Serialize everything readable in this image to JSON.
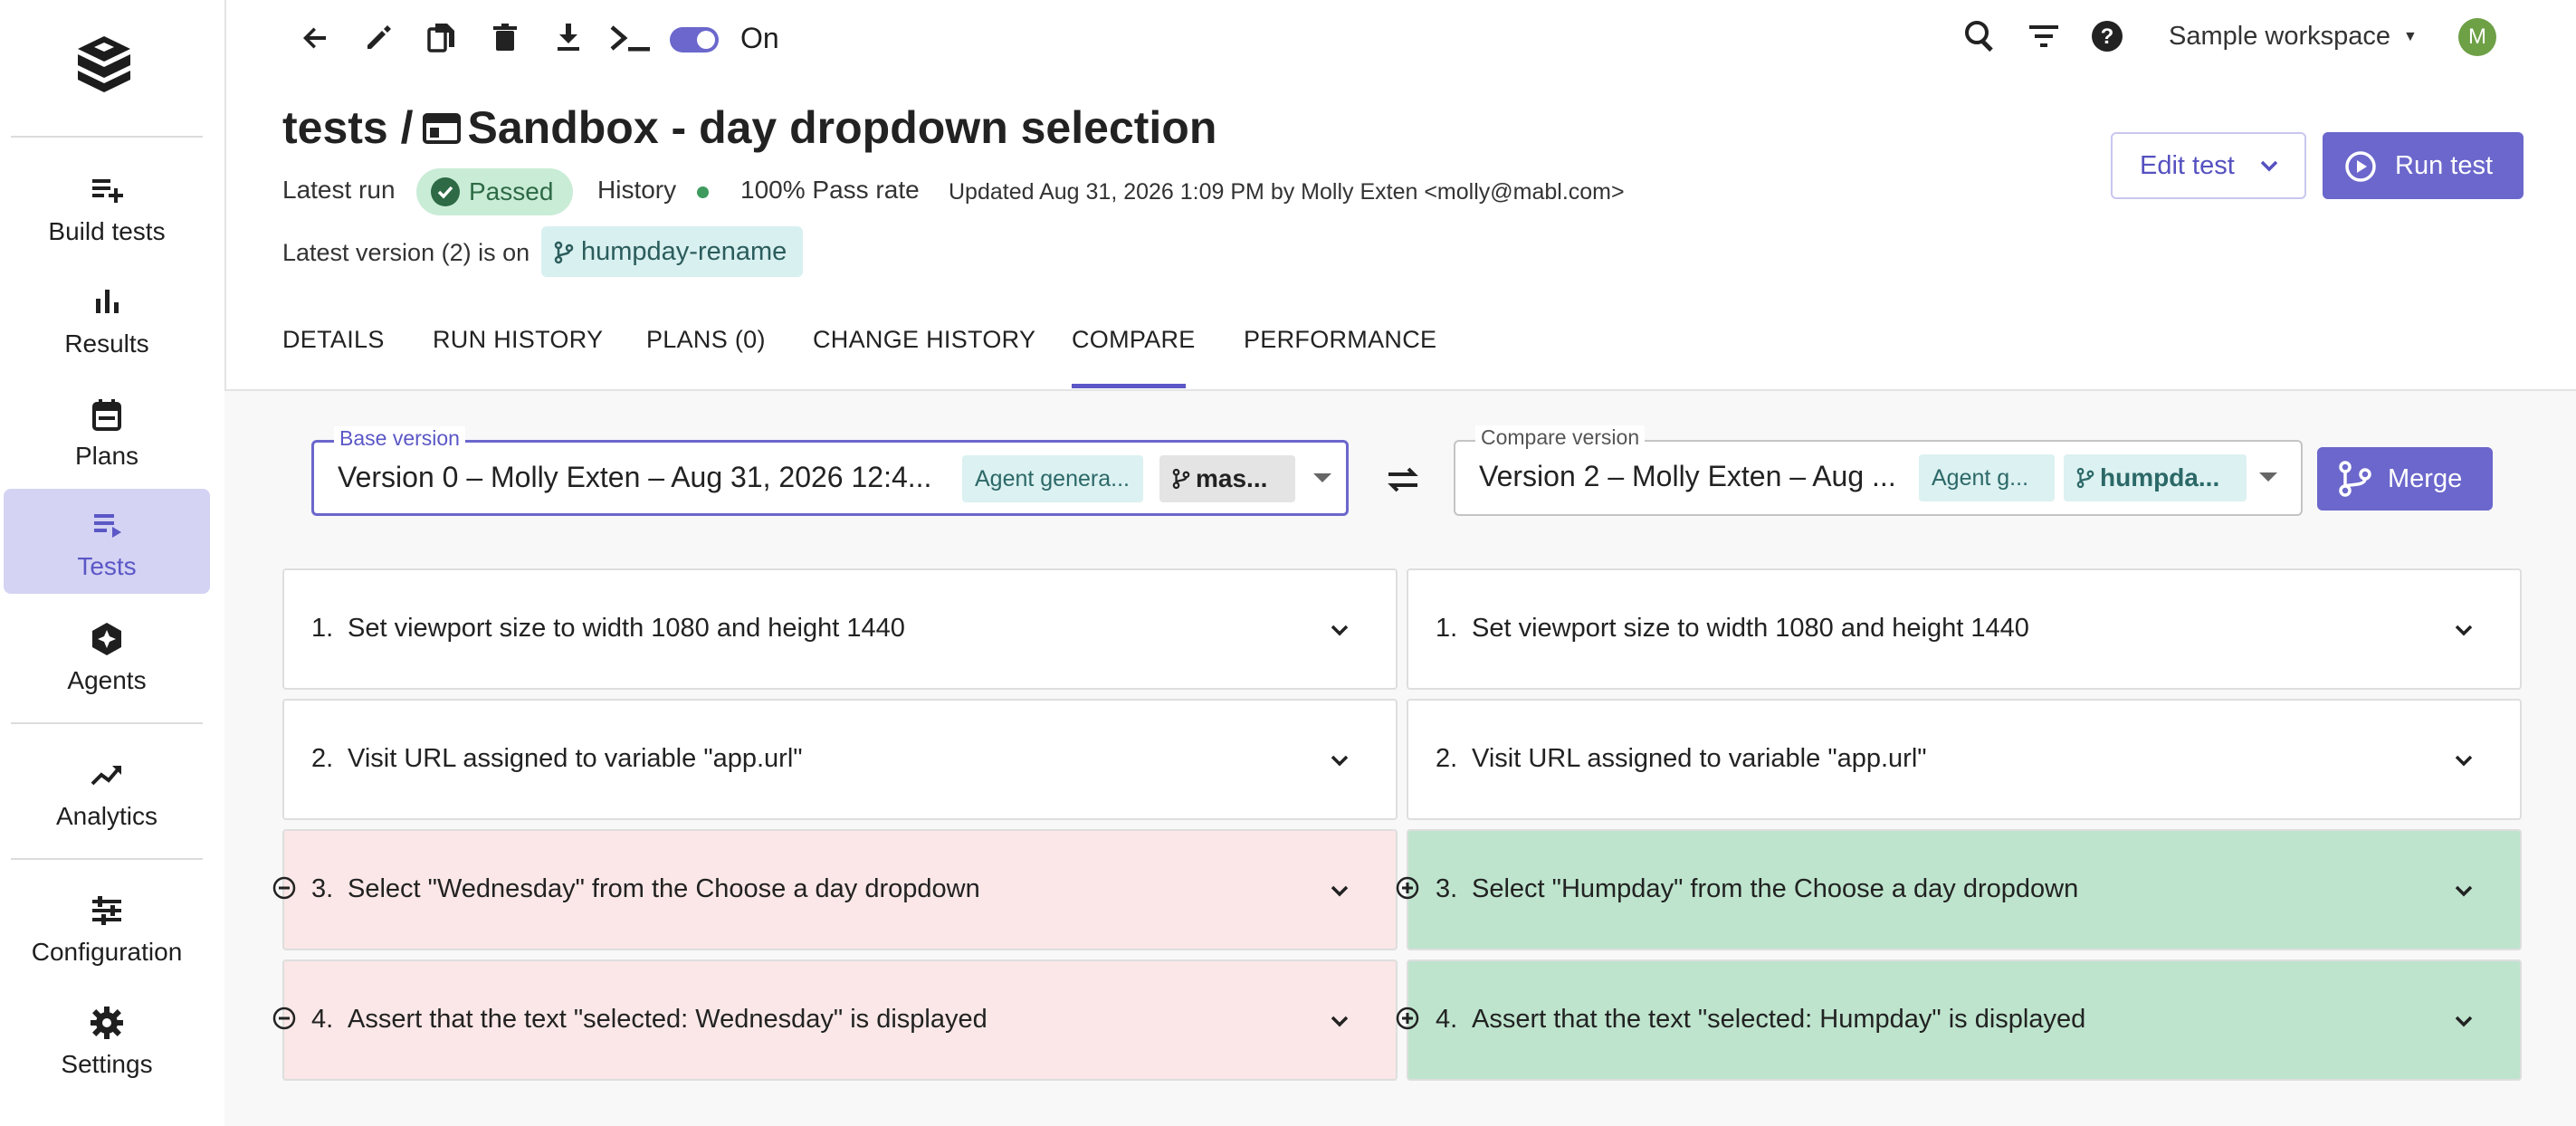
{
  "sidebar": {
    "items": [
      {
        "label": "Build tests",
        "icon": "build-tests-icon"
      },
      {
        "label": "Results",
        "icon": "bar-chart-icon"
      },
      {
        "label": "Plans",
        "icon": "calendar-icon"
      },
      {
        "label": "Tests",
        "icon": "list-icon",
        "active": true
      },
      {
        "label": "Agents",
        "icon": "agent-icon"
      },
      {
        "label": "Analytics",
        "icon": "trend-icon"
      },
      {
        "label": "Configuration",
        "icon": "sliders-icon"
      },
      {
        "label": "Settings",
        "icon": "gear-icon"
      }
    ]
  },
  "toolbar": {
    "toggle_label": "On",
    "workspace": "Sample workspace",
    "avatar_initial": "M"
  },
  "header": {
    "breadcrumb": "tests /",
    "title": "Sandbox - day dropdown selection",
    "latest_run_label": "Latest run",
    "status": "Passed",
    "history_label": "History",
    "pass_rate": "100% Pass rate",
    "updated": "Updated Aug 31, 2026 1:09 PM by Molly Exten <molly@mabl.com>",
    "latest_version_text": "Latest version (2) is on",
    "branch": "humpday-rename",
    "edit_label": "Edit test",
    "run_label": "Run test"
  },
  "tabs": [
    "DETAILS",
    "RUN HISTORY",
    "PLANS (0)",
    "CHANGE HISTORY",
    "COMPARE",
    "PERFORMANCE"
  ],
  "active_tab": "COMPARE",
  "compare": {
    "base": {
      "legend": "Base version",
      "value": "Version 0 – Molly Exten – Aug 31, 2026 12:4...",
      "agent_chip": "Agent genera...",
      "branch_chip": "mas..."
    },
    "target": {
      "legend": "Compare version",
      "value": "Version 2 – Molly Exten – Aug ...",
      "agent_chip": "Agent g...",
      "branch_chip": "humpda..."
    },
    "merge_label": "Merge",
    "left_steps": [
      {
        "num": "1.",
        "text": "Set viewport size to width 1080 and height 1440",
        "state": "same"
      },
      {
        "num": "2.",
        "text": "Visit URL assigned to variable \"app.url\"",
        "state": "same"
      },
      {
        "num": "3.",
        "text": "Select \"Wednesday\" from the Choose a day dropdown",
        "state": "removed"
      },
      {
        "num": "4.",
        "text": "Assert that the text \"selected: Wednesday\" is displayed",
        "state": "removed"
      }
    ],
    "right_steps": [
      {
        "num": "1.",
        "text": "Set viewport size to width 1080 and height 1440",
        "state": "same"
      },
      {
        "num": "2.",
        "text": "Visit URL assigned to variable \"app.url\"",
        "state": "same"
      },
      {
        "num": "3.",
        "text": "Select \"Humpday\" from the Choose a day dropdown",
        "state": "added"
      },
      {
        "num": "4.",
        "text": "Assert that the text \"selected: Humpday\" is displayed",
        "state": "added"
      }
    ]
  },
  "colors": {
    "accent": "#6b67cc",
    "removed_bg": "#fbe7e7",
    "added_bg": "#bee4cd",
    "passed_bg": "#c9ecd6"
  }
}
